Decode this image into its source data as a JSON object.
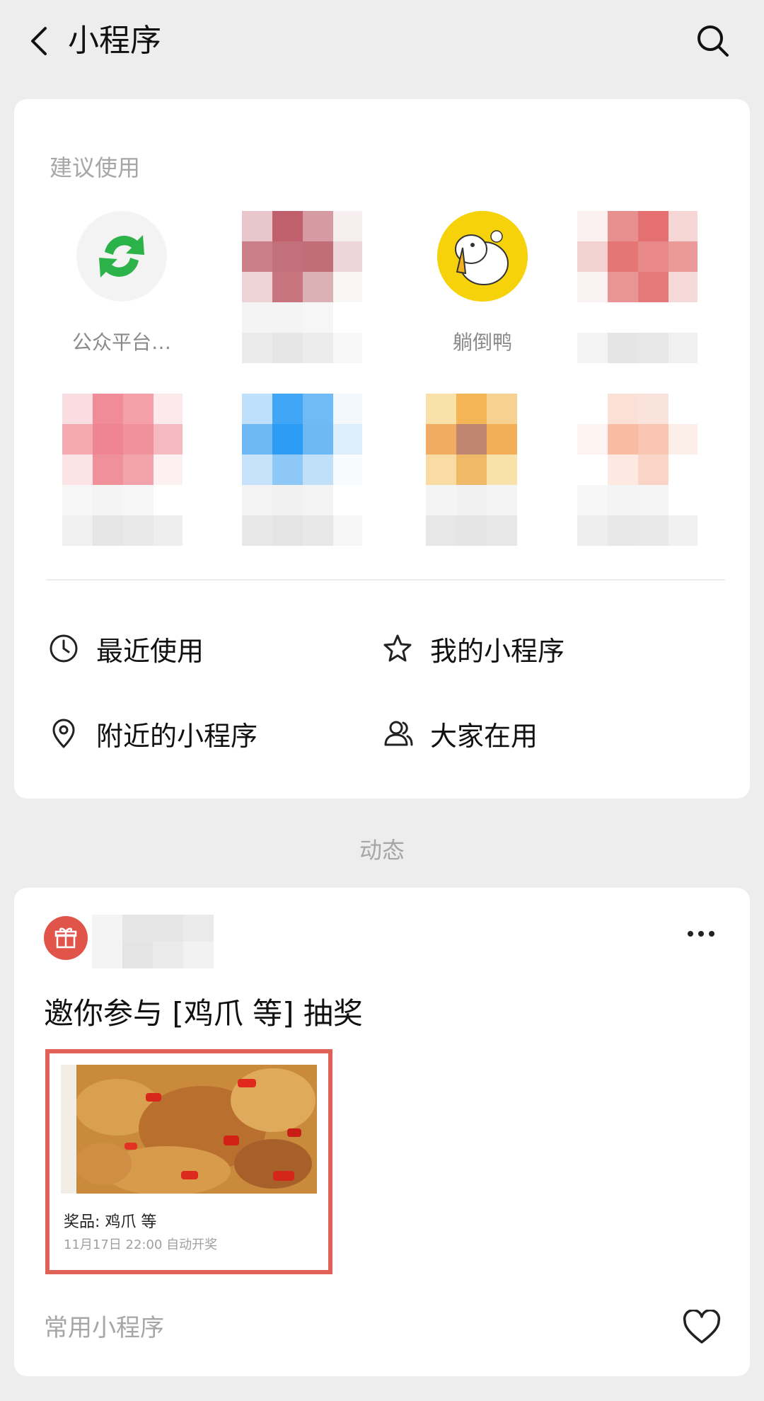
{
  "header": {
    "title": "小程序",
    "back_icon": "chevron-left-icon",
    "search_icon": "search-icon"
  },
  "suggested": {
    "label": "建议使用",
    "apps": [
      {
        "name": "公众平台…",
        "icon": "wechat-mp-logo",
        "blurred": false
      },
      {
        "name": "",
        "icon": "pixelated-icon",
        "blurred": true,
        "color": "#c8727e"
      },
      {
        "name": "躺倒鸭",
        "icon": "duck-logo",
        "blurred": false
      },
      {
        "name": "",
        "icon": "pixelated-icon",
        "blurred": true,
        "color": "#e47c7c"
      },
      {
        "name": "",
        "icon": "pixelated-icon",
        "blurred": true,
        "color": "#f08c93"
      },
      {
        "name": "",
        "icon": "pixelated-icon",
        "blurred": true,
        "color": "#4aa8f4"
      },
      {
        "name": "",
        "icon": "pixelated-icon",
        "blurred": true,
        "color": "#eeae5c"
      },
      {
        "name": "",
        "icon": "pixelated-icon",
        "blurred": true,
        "color": "#f7c3ae"
      }
    ]
  },
  "menu": {
    "recent": {
      "label": "最近使用",
      "icon": "clock-icon"
    },
    "mine": {
      "label": "我的小程序",
      "icon": "star-icon"
    },
    "nearby": {
      "label": "附近的小程序",
      "icon": "location-pin-icon"
    },
    "popular": {
      "label": "大家在用",
      "icon": "people-icon"
    }
  },
  "feed": {
    "heading": "动态",
    "post": {
      "avatar_icon": "gift-icon",
      "title": "邀你参与 [鸡爪 等] 抽奖",
      "prize_line": "奖品: 鸡爪 等",
      "draw_time": "11月17日 22:00 自动开奖",
      "more_icon": "more-dots-icon"
    },
    "footer_label": "常用小程序",
    "like_icon": "heart-icon"
  },
  "colors": {
    "background": "#ededed",
    "card": "#ffffff",
    "accent_red": "#e1544a",
    "wechat_green": "#2bb34a",
    "duck_yellow": "#f5d20a",
    "muted_text": "#a6a6a6"
  }
}
